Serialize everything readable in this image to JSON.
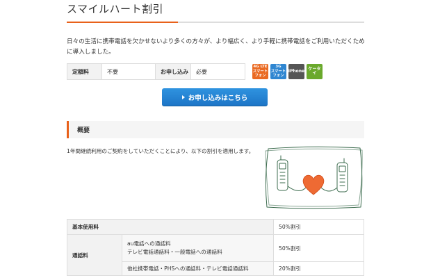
{
  "page": {
    "title": "スマイルハート割引",
    "intro": "日々の生活に携帯電話を欠かせないより多くの方々が、より幅広く、より手軽に携帯電話をご利用いただくために導入しました。"
  },
  "fee": {
    "label1": "定額料",
    "value1": "不要",
    "label2": "お申し込み",
    "value2": "必要"
  },
  "badges": [
    {
      "line1": "4G LTE",
      "line2": "スマート",
      "line3": "フォン",
      "color": "#ea6a22"
    },
    {
      "line1": "3G",
      "line2": "スマート",
      "line3": "フォン",
      "color": "#2f86d1"
    },
    {
      "line1": "iPhone",
      "color": "#555555"
    },
    {
      "line1": "ケータイ",
      "color": "#6aa92c"
    }
  ],
  "apply_button": {
    "label": "お申し込みはこちら",
    "icon": "triangle-right-icon"
  },
  "overview": {
    "heading": "概要",
    "description": "1年間継続利用のご契約をしていただくことにより、以下の割引を適用します。"
  },
  "discount_table": {
    "rows": [
      {
        "category": "基本使用料",
        "item": "",
        "rate": "50%割引"
      },
      {
        "category": "通話料",
        "item_line1": "au電話への通話料",
        "item_line2": "テレビ電話通話料・一般電話への通話料",
        "rate": "50%割引"
      },
      {
        "item": "他社携帯電話・PHSへの通話料・テレビ電話通話料",
        "rate": "20%割引"
      }
    ]
  },
  "colors": {
    "accent": "#e8611a",
    "button": "#1d75c7"
  }
}
